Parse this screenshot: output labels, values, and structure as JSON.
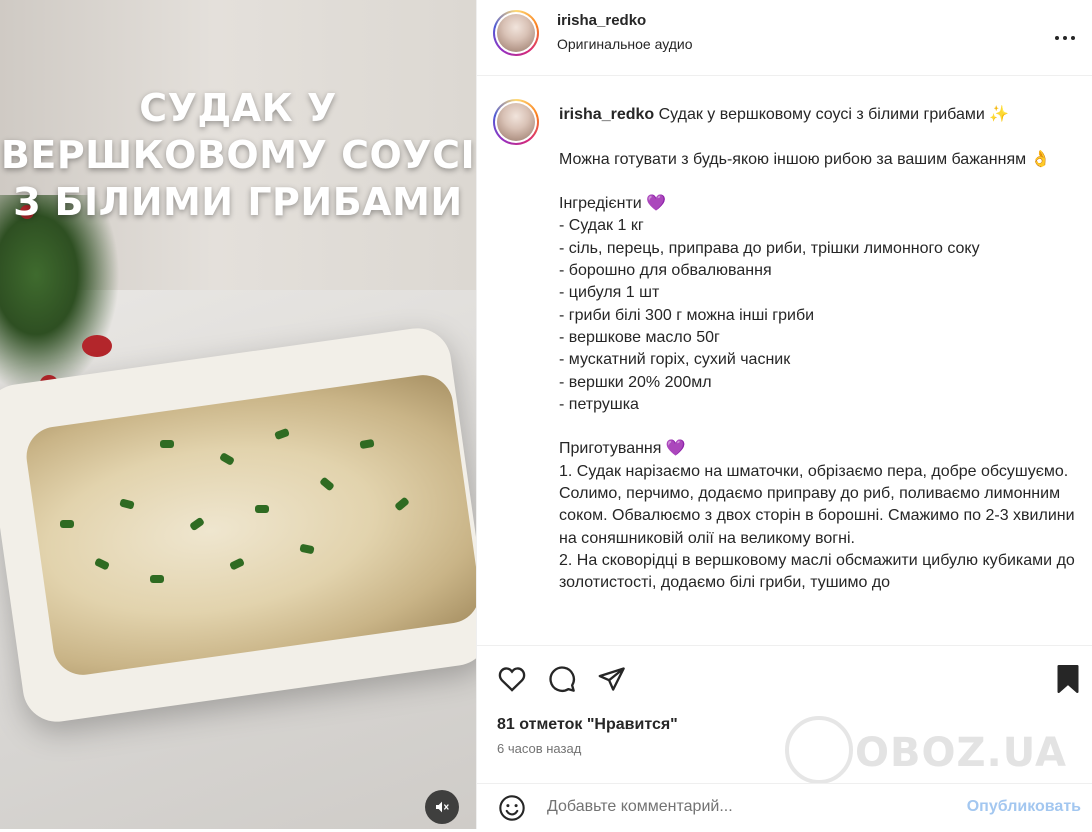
{
  "media": {
    "overlay_title": "СУДАК У ВЕРШКОВОМУ СОУСІ З БІЛИМИ ГРИБАМИ",
    "mute_icon": "speaker-muted-icon"
  },
  "header": {
    "username": "irisha_redko",
    "audio": "Оригинальное аудио",
    "more_icon": "more-horizontal-icon"
  },
  "caption": {
    "username": "irisha_redko",
    "text": " Судак у вершковому соусі з білими грибами ✨\n\nМожна готувати з будь-якою іншою рибою за вашим бажанням 👌\n\nІнгредієнти 💜\n- Судак 1 кг\n- сіль, перець, приправа до риби, трішки лимонного соку\n- борошно для обвалювання\n- цибуля 1 шт\n- гриби білі 300 г можна інші гриби\n- вершкове масло 50г\n- мускатний горіх, сухий часник\n- вершки 20% 200мл\n- петрушка\n\nПриготування 💜\n1. Судак нарізаємо на шматочки, обрізаємо пера, добре обсушуємо. Солимо, перчимо, додаємо приправу до риб, поливаємо лимонним соком. Обвалюємо з двох сторін в борошні. Смажимо по 2-3 хвилини на соняшниковій олії на великому вогні.\n2. На сковорідці в вершковому маслі обсмажити цибулю кубиками до золотистості, додаємо білі гриби, тушимо до"
  },
  "actions": {
    "like_icon": "heart-icon",
    "comment_icon": "comment-icon",
    "share_icon": "share-icon",
    "save_icon": "bookmark-icon",
    "likes": "81 отметок \"Нравится\"",
    "time": "6 часов назад"
  },
  "comment": {
    "placeholder": "Добавьте комментарий...",
    "publish": "Опубликовать",
    "emoji_icon": "emoji-icon"
  },
  "watermark": "OBOZ.UA"
}
